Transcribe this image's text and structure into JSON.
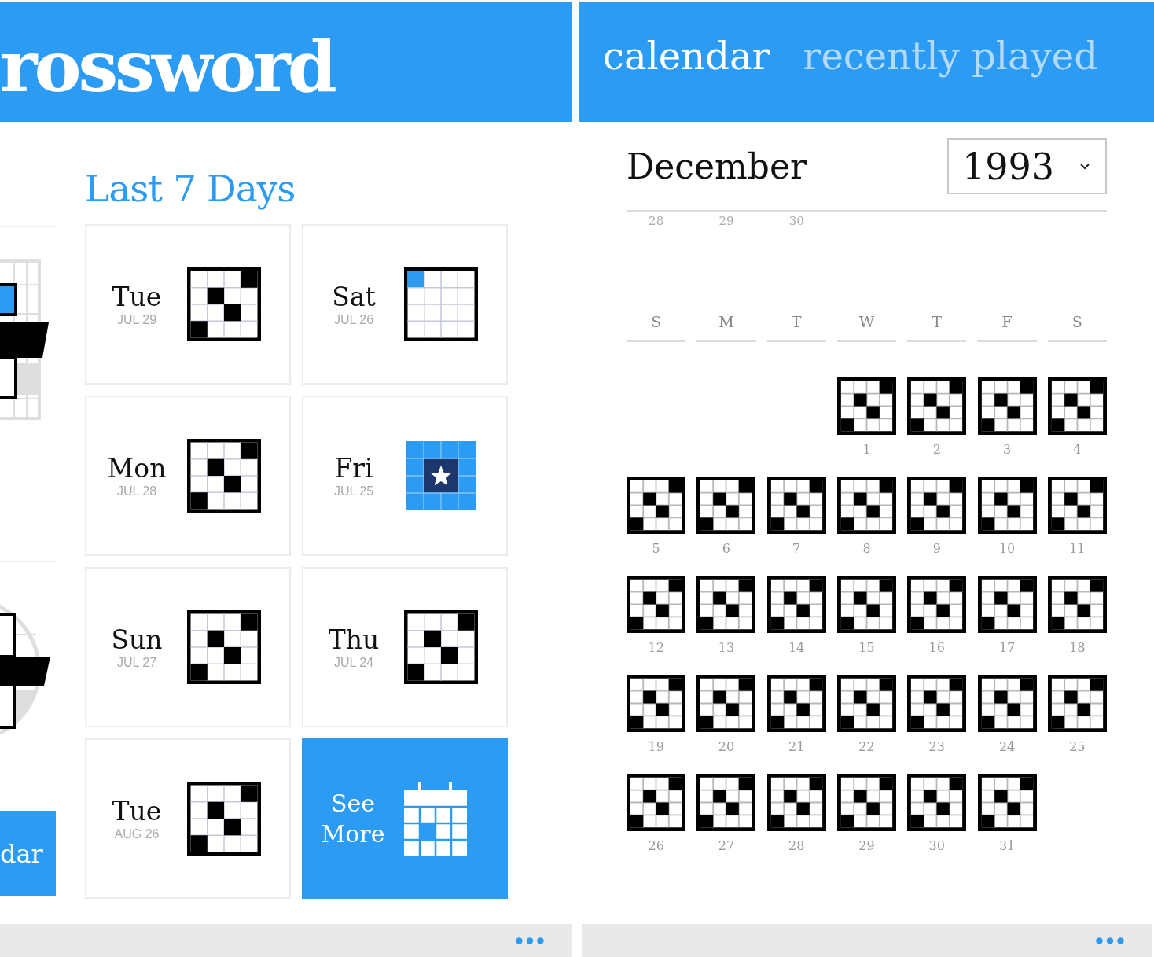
{
  "left_screen": {
    "title": "rossword",
    "side_button": "dar",
    "section_title": "Last 7 Days",
    "tiles": [
      {
        "kind": "unplayed",
        "day": "Tue",
        "date": "JUL 29"
      },
      {
        "kind": "started",
        "day": "Sat",
        "date": "JUL 26"
      },
      {
        "kind": "unplayed",
        "day": "Mon",
        "date": "JUL 28"
      },
      {
        "kind": "solved",
        "day": "Fri",
        "date": "JUL 25"
      },
      {
        "kind": "unplayed",
        "day": "Sun",
        "date": "JUL 27"
      },
      {
        "kind": "unplayed",
        "day": "Thu",
        "date": "JUL 24"
      },
      {
        "kind": "unplayed",
        "day": "Tue",
        "date": "AUG 26"
      },
      {
        "kind": "more",
        "label": "See More"
      }
    ]
  },
  "right_screen": {
    "tabs": [
      {
        "label": "calendar",
        "selected": true
      },
      {
        "label": "recently played",
        "selected": false
      }
    ],
    "month": "December",
    "year": "1993",
    "week_above": [
      "28",
      "29",
      "30"
    ],
    "weekdays": [
      "S",
      "M",
      "T",
      "W",
      "T",
      "F",
      "S"
    ],
    "weeks": [
      [
        "1",
        "2",
        "3",
        "4"
      ],
      [
        "5",
        "6",
        "7",
        "8",
        "9",
        "10",
        "11"
      ],
      [
        "12",
        "13",
        "14",
        "15",
        "16",
        "17",
        "18"
      ],
      [
        "19",
        "20",
        "21",
        "22",
        "23",
        "24",
        "25"
      ],
      [
        "26",
        "27",
        "28",
        "29",
        "30",
        "31"
      ]
    ]
  }
}
